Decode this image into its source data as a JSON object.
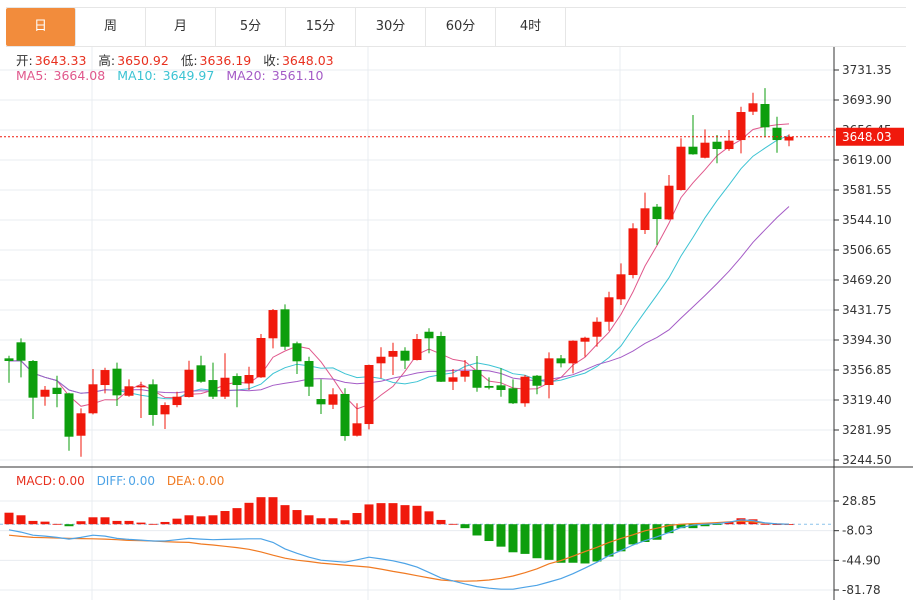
{
  "tabs": [
    {
      "label": "日",
      "active": true
    },
    {
      "label": "周",
      "active": false
    },
    {
      "label": "月",
      "active": false
    },
    {
      "label": "5分",
      "active": false
    },
    {
      "label": "15分",
      "active": false
    },
    {
      "label": "30分",
      "active": false
    },
    {
      "label": "60分",
      "active": false
    },
    {
      "label": "4时",
      "active": false
    }
  ],
  "ohlc_info": {
    "open_label": "开:",
    "open": "3643.33",
    "high_label": "高:",
    "high": "3650.92",
    "low_label": "低:",
    "low": "3636.19",
    "close_label": "收:",
    "close": "3648.03"
  },
  "ma_info": {
    "ma5_label": "MA5:",
    "ma5": "3664.08",
    "ma10_label": "MA10:",
    "ma10": "3649.97",
    "ma20_label": "MA20:",
    "ma20": "3561.10"
  },
  "macd_info": {
    "macd_label": "MACD:",
    "macd": "0.00",
    "diff_label": "DIFF:",
    "diff": "0.00",
    "dea_label": "DEA:",
    "dea": "0.00"
  },
  "colors": {
    "up": "#f0190c",
    "down": "#0d9e0d",
    "ma5": "#e0588c",
    "ma10": "#3cc3d3",
    "ma20": "#a45bc6",
    "diff": "#4da3e6",
    "dea": "#f07a22",
    "tab_active": "#f28c3c",
    "last_price_bg": "#f0190c"
  },
  "chart_data": [
    {
      "type": "candlestick",
      "price_axis_ticks": [
        "3731.35",
        "3693.90",
        "3656.45",
        "3619.00",
        "3581.55",
        "3544.10",
        "3506.65",
        "3469.20",
        "3431.75",
        "3394.30",
        "3356.85",
        "3319.40",
        "3281.95",
        "3244.50"
      ],
      "ylim": [
        3244.5,
        3731.35
      ],
      "last_price": "3648.03",
      "grid": true,
      "ma_periods": [
        5,
        10,
        20
      ],
      "ohlc": [
        [
          3371.4,
          3374.7,
          3341.0,
          3368.1
        ],
        [
          3391.4,
          3396.4,
          3347.7,
          3368.5
        ],
        [
          3368.1,
          3369.3,
          3295.7,
          3322.3
        ],
        [
          3323.5,
          3336.9,
          3312.3,
          3332.2
        ],
        [
          3334.7,
          3349.7,
          3310.3,
          3326.9
        ],
        [
          3327.7,
          3328.5,
          3256.1,
          3273.6
        ],
        [
          3274.8,
          3309.0,
          3248.6,
          3302.8
        ],
        [
          3302.8,
          3358.1,
          3301.5,
          3339.0
        ],
        [
          3338.1,
          3359.7,
          3327.7,
          3356.8
        ],
        [
          3358.5,
          3366.0,
          3311.9,
          3325.2
        ],
        [
          3324.7,
          3345.2,
          3323.5,
          3336.5
        ],
        [
          3335.2,
          3342.2,
          3296.9,
          3337.2
        ],
        [
          3339.0,
          3345.2,
          3287.3,
          3300.7
        ],
        [
          3301.5,
          3316.5,
          3283.2,
          3313.1
        ],
        [
          3313.1,
          3329.7,
          3310.3,
          3323.5
        ],
        [
          3323.1,
          3368.4,
          3322.5,
          3357.2
        ],
        [
          3362.7,
          3374.7,
          3341.0,
          3342.2
        ],
        [
          3344.3,
          3366.0,
          3320.6,
          3323.5
        ],
        [
          3323.5,
          3377.7,
          3320.6,
          3347.2
        ],
        [
          3349.3,
          3352.7,
          3310.3,
          3338.1
        ],
        [
          3340.2,
          3360.9,
          3331.9,
          3350.6
        ],
        [
          3347.7,
          3401.8,
          3347.0,
          3396.8
        ],
        [
          3396.4,
          3433.0,
          3383.9,
          3431.7
        ],
        [
          3432.6,
          3438.8,
          3381.8,
          3385.9
        ],
        [
          3390.2,
          3392.2,
          3351.8,
          3367.7
        ],
        [
          3368.1,
          3373.4,
          3324.4,
          3336.0
        ],
        [
          3320.6,
          3345.2,
          3301.9,
          3314.0
        ],
        [
          3313.5,
          3334.0,
          3308.1,
          3326.5
        ],
        [
          3326.9,
          3334.0,
          3268.6,
          3274.4
        ],
        [
          3274.8,
          3315.3,
          3273.8,
          3290.3
        ],
        [
          3289.4,
          3363.6,
          3282.8,
          3363.1
        ],
        [
          3365.2,
          3385.2,
          3346.5,
          3373.4
        ],
        [
          3373.4,
          3390.9,
          3350.6,
          3380.6
        ],
        [
          3380.9,
          3385.2,
          3358.1,
          3368.5
        ],
        [
          3369.3,
          3401.8,
          3368.7,
          3395.5
        ],
        [
          3404.6,
          3408.9,
          3377.7,
          3396.4
        ],
        [
          3399.3,
          3404.6,
          3341.9,
          3342.2
        ],
        [
          3342.2,
          3358.1,
          3331.9,
          3347.7
        ],
        [
          3348.5,
          3369.3,
          3342.2,
          3355.6
        ],
        [
          3356.8,
          3374.3,
          3329.7,
          3334.7
        ],
        [
          3336.9,
          3347.7,
          3332.7,
          3334.7
        ],
        [
          3337.7,
          3359.0,
          3323.5,
          3331.9
        ],
        [
          3334.0,
          3345.2,
          3314.4,
          3315.3
        ],
        [
          3315.3,
          3350.6,
          3311.0,
          3348.5
        ],
        [
          3349.7,
          3350.6,
          3326.5,
          3337.2
        ],
        [
          3338.1,
          3378.9,
          3321.5,
          3371.4
        ],
        [
          3371.4,
          3375.6,
          3360.2,
          3365.2
        ],
        [
          3365.2,
          3393.8,
          3352.7,
          3393.4
        ],
        [
          3392.2,
          3398.4,
          3373.4,
          3397.1
        ],
        [
          3398.4,
          3422.6,
          3385.9,
          3417.1
        ],
        [
          3417.1,
          3454.6,
          3405.9,
          3447.6
        ],
        [
          3445.1,
          3490.0,
          3438.0,
          3476.3
        ],
        [
          3475.4,
          3540.0,
          3471.3,
          3533.7
        ],
        [
          3531.6,
          3578.2,
          3526.6,
          3558.7
        ],
        [
          3560.7,
          3564.0,
          3512.9,
          3545.3
        ],
        [
          3544.9,
          3600.2,
          3544.2,
          3586.9
        ],
        [
          3581.5,
          3646.1,
          3580.8,
          3635.6
        ],
        [
          3635.6,
          3675.1,
          3625.5,
          3626.1
        ],
        [
          3621.8,
          3657.3,
          3621.0,
          3640.6
        ],
        [
          3641.8,
          3650.2,
          3614.9,
          3632.7
        ],
        [
          3632.7,
          3656.4,
          3630.6,
          3643.1
        ],
        [
          3643.9,
          3685.5,
          3627.3,
          3678.9
        ],
        [
          3679.3,
          3703.0,
          3675.1,
          3689.8
        ],
        [
          3688.9,
          3708.8,
          3647.3,
          3659.8
        ],
        [
          3659.3,
          3673.0,
          3628.1,
          3643.9
        ],
        [
          3643.33,
          3650.92,
          3636.19,
          3648.03
        ]
      ]
    },
    {
      "type": "bar+line",
      "indicator": "MACD",
      "axis_ticks": [
        "28.85",
        "-8.03",
        "-44.90",
        "-81.78"
      ],
      "ylim": [
        -81.78,
        28.85
      ],
      "macd": [
        14.3,
        11.1,
        4.1,
        3.2,
        0.4,
        -2.5,
        3.7,
        8.6,
        8.6,
        4.1,
        4.1,
        2.0,
        0.4,
        2.8,
        6.9,
        11.1,
        9.8,
        11.1,
        16.4,
        20.0,
        26.6,
        33.6,
        33.6,
        23.7,
        17.6,
        11.1,
        7.4,
        7.4,
        4.9,
        13.9,
        24.6,
        26.2,
        26.2,
        23.7,
        22.9,
        16.0,
        5.3,
        0.4,
        -4.9,
        -14.0,
        -20.9,
        -27.9,
        -34.9,
        -36.9,
        -42.3,
        -44.3,
        -47.9,
        -47.9,
        -48.8,
        -46.3,
        -40.2,
        -33.7,
        -25.1,
        -22.1,
        -19.3,
        -11.1,
        -4.9,
        -4.9,
        -2.5,
        -0.8,
        2.8,
        7.4,
        6.1,
        0.4,
        0,
        0
      ],
      "diff": [
        -6.9,
        -9.8,
        -13.6,
        -14.8,
        -16.4,
        -18.5,
        -16.4,
        -13.6,
        -14.8,
        -17.7,
        -18.9,
        -19.7,
        -20.9,
        -20.9,
        -19.3,
        -17.7,
        -18.5,
        -19.3,
        -18.9,
        -18.5,
        -18.1,
        -18.1,
        -22.6,
        -30.7,
        -36.1,
        -41.0,
        -44.7,
        -46.0,
        -47.2,
        -44.3,
        -41.0,
        -43.1,
        -45.5,
        -48.8,
        -53.3,
        -59.9,
        -66.8,
        -70.5,
        -74.2,
        -77.5,
        -79.5,
        -80.8,
        -80.8,
        -78.3,
        -75.9,
        -71.8,
        -67.6,
        -61.5,
        -54.5,
        -47.2,
        -39.0,
        -32.8,
        -25.8,
        -20.5,
        -15.6,
        -10.2,
        -4.1,
        -1.2,
        0,
        0.8,
        2.5,
        5.3,
        4.5,
        1.6,
        0.4,
        0
      ],
      "dea": [
        -13.6,
        -15.2,
        -16.4,
        -16.8,
        -17.2,
        -17.7,
        -17.9,
        -18.1,
        -18.5,
        -19.3,
        -20.1,
        -20.5,
        -20.9,
        -21.8,
        -22.2,
        -22.6,
        -24.6,
        -25.8,
        -27.5,
        -29.1,
        -31.2,
        -34.4,
        -38.5,
        -42.2,
        -44.7,
        -46.4,
        -48.4,
        -49.6,
        -50.8,
        -52.1,
        -53.3,
        -55.8,
        -58.6,
        -61.1,
        -64.0,
        -66.8,
        -69.3,
        -70.5,
        -70.9,
        -70.5,
        -69.3,
        -67.2,
        -64.4,
        -60.3,
        -55.4,
        -49.2,
        -45.1,
        -39.8,
        -34.0,
        -28.7,
        -22.6,
        -17.7,
        -13.2,
        -8.2,
        -4.9,
        -1.6,
        0,
        0.8,
        1.2,
        2.0,
        2.9,
        3.7,
        2.9,
        1.2,
        0.4,
        0
      ]
    }
  ]
}
